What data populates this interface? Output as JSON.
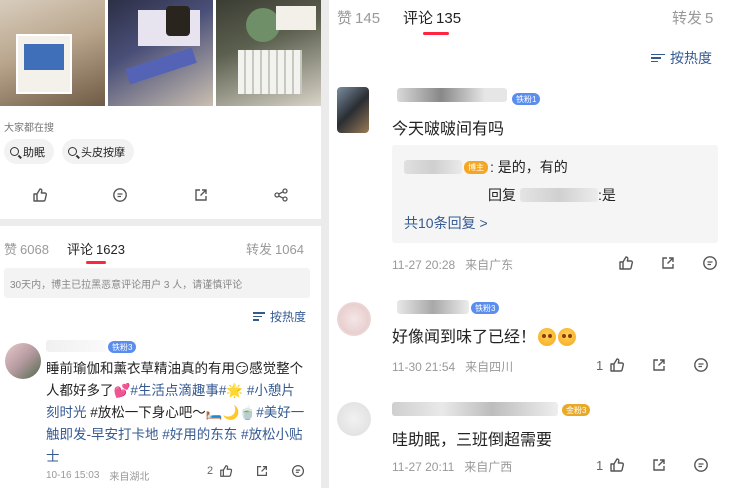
{
  "left": {
    "search_label": "大家都在搜",
    "chips": [
      "助眠",
      "头皮按摩"
    ],
    "tabs": {
      "likes_label": "赞",
      "likes": "6068",
      "comments_label": "评论",
      "comments": "1623",
      "shares_label": "转发",
      "shares": "1064"
    },
    "notice": "30天内，博主已拉黑恶意评论用户 3 人，请谨慎评论",
    "sort_label": "按热度",
    "comment": {
      "badge": "铁粉3",
      "text_parts": [
        {
          "t": "睡前瑜伽和薰衣草精油真的有用😏感觉整个人都好多了💕",
          "hash": false
        },
        {
          "t": "#生活点滴趣事#🌟",
          "hash": true
        },
        {
          "t": " ",
          "hash": false
        },
        {
          "t": "#小憩片刻时光",
          "hash": true
        },
        {
          "t": " #放松一下身心吧～🛏️🌙🍵",
          "hash": false
        },
        {
          "t": "#美好一触即发-早安打卡地",
          "hash": true
        },
        {
          "t": " ",
          "hash": false
        },
        {
          "t": "#好用的东东",
          "hash": true
        },
        {
          "t": " ",
          "hash": false
        },
        {
          "t": "#放松小贴士",
          "hash": true
        }
      ],
      "time": "10-16 15:03",
      "location": "来自湖北",
      "likes": "2"
    }
  },
  "right": {
    "tabs": {
      "likes_label": "赞",
      "likes": "145",
      "comments_label": "评论",
      "comments": "135",
      "shares_label": "转发",
      "shares": "5"
    },
    "sort_label": "按热度",
    "comments": [
      {
        "badge": "铁粉1",
        "text": "今天啵啵间有吗",
        "replies": [
          {
            "author_badge": "博主",
            "text": ": 是的，有的"
          },
          {
            "prefix": "回复",
            "text": ":是"
          }
        ],
        "more": "共10条回复 >",
        "time": "11-27 20:28",
        "location": "来自广东",
        "likes": ""
      },
      {
        "badge": "铁粉3",
        "text": "好像闻到味了已经！",
        "time": "11-30 21:54",
        "location": "来自四川",
        "likes": "1"
      },
      {
        "badge": "金粉3",
        "text": "哇助眠，三班倒超需要",
        "time": "11-27 20:11",
        "location": "来自广西",
        "likes": "1"
      }
    ]
  },
  "colors": {
    "accent": "#ff2442",
    "link": "#355a92",
    "badge_blue": "#5b8def",
    "badge_orange": "#f5a623",
    "badge_gold": "#e9a928"
  }
}
